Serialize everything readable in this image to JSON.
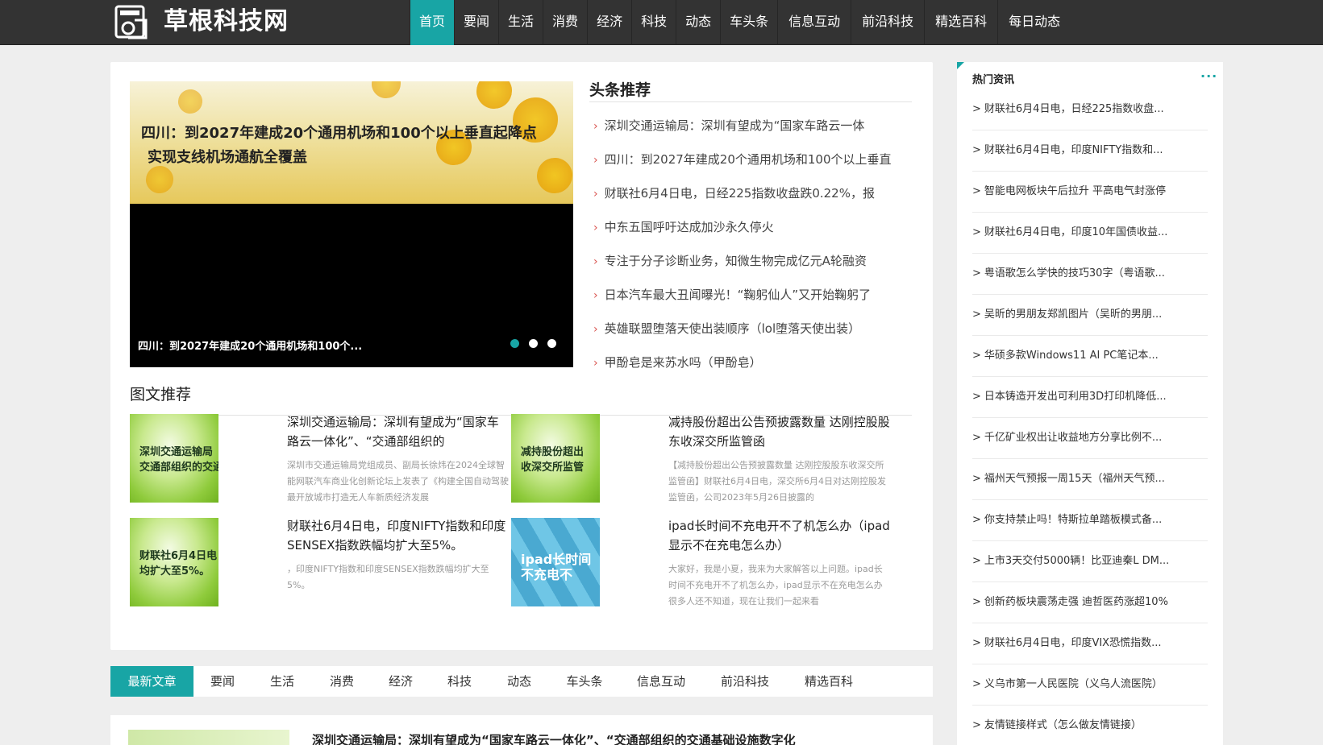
{
  "site": {
    "name": "草根科技网",
    "logo_icon": "news-logo-icon"
  },
  "nav": {
    "items": [
      "首页",
      "要闻",
      "生活",
      "消费",
      "经济",
      "科技",
      "动态",
      "车头条",
      "信息互动",
      "前沿科技",
      "精选百科",
      "每日动态"
    ],
    "active_index": 0
  },
  "slider": {
    "headline_line1": "四川：到2027年建成20个通用机场和100个以上垂直起降点",
    "headline_line2": "实现支线机场通航全覆盖",
    "caption": "四川：到2027年建成20个通用机场和100个...",
    "dots": 3,
    "active_dot": 0
  },
  "headlines": {
    "title": "头条推荐",
    "items": [
      "深圳交通运输局：深圳有望成为“国家车路云一体",
      "四川：到2027年建成20个通用机场和100个以上垂直",
      "财联社6月4日电，日经225指数收盘跌0.22%，报",
      "中东五国呼吁达成加沙永久停火",
      "专注于分子诊断业务，知微生物完成亿元A轮融资",
      "日本汽车最大丑闻曝光！“鞠躬仙人”又开始鞠躬了",
      "英雄联盟堕落天使出装顺序（lol堕落天使出装）",
      "甲酚皂是来苏水吗（甲酚皂）"
    ]
  },
  "picture_news": {
    "title": "图文推荐",
    "items": [
      {
        "thumb_text": "深圳交通运输局\n交通部组织的交通",
        "headline": "深圳交通运输局：深圳有望成为“国家车路云一体化”、“交通部组织的",
        "desc": "深圳市交通运输局党组成员、副局长徐炜在2024全球智能网联汽车商业化创新论坛上发表了《构建全国自动驾驶最开放城市打造无人车新质经济发展"
      },
      {
        "thumb_text": "减持股份超出\n收深交所监管",
        "headline": "减持股份超出公告预披露数量 达刚控股股东收深交所监管函",
        "desc": "【减持股份超出公告预披露数量 达刚控股股东收深交所监管函】财联社6月4日电，深交所6月4日对达刚控股发监管函，公司2023年5月26日披露的"
      },
      {
        "thumb_text": "财联社6月4日电\n均扩大至5%。",
        "headline": "财联社6月4日电，印度NIFTY指数和印度SENSEX指数跌幅均扩大至5%。",
        "desc": "，印度NIFTY指数和印度SENSEX指数跌幅均扩大至5%。"
      },
      {
        "thumb_text": "ipad长时间\n不充电不",
        "headline": "ipad长时间不充电开不了机怎么办（ipad显示不在充电怎么办）",
        "desc": "大家好，我是小夏，我来为大家解答以上问题。ipad长时间不充电开不了机怎么办，ipad显示不在充电怎么办很多人还不知道，现在让我们一起来看"
      }
    ]
  },
  "tabs": {
    "items": [
      "最新文章",
      "要闻",
      "生活",
      "消费",
      "经济",
      "科技",
      "动态",
      "车头条",
      "信息互动",
      "前沿科技",
      "精选百科"
    ],
    "active_index": 0
  },
  "latest": {
    "first_title": "深圳交通运输局：深圳有望成为“国家车路云一体化”、“交通部组织的交通基础设施数字化"
  },
  "hot": {
    "title": "热门资讯",
    "more": "···",
    "items": [
      "财联社6月4日电，日经225指数收盘...",
      "财联社6月4日电，印度NIFTY指数和...",
      "智能电网板块午后拉升 平高电气封涨停",
      "财联社6月4日电，印度10年国债收益...",
      "粤语歌怎么学快的技巧30字（粤语歌...",
      "吴昕的男朋友郑凯图片（吴昕的男朋...",
      "华硕多款Windows11 AI PC笔记本...",
      "日本铸造开发出可利用3D打印机降低...",
      "千亿矿业权出让收益地方分享比例不...",
      "福州天气预报一周15天（福州天气预...",
      "你支持禁止吗！特斯拉单踏板模式备...",
      "上市3天交付5000辆！比亚迪秦L DM...",
      "创新药板块震荡走强 迪哲医药涨超10%",
      "财联社6月4日电，印度VIX恐慌指数...",
      "义乌市第一人民医院（义乌人流医院）",
      "友情链接样式（怎么做友情链接）"
    ]
  },
  "colors": {
    "accent": "#18a5a5",
    "topbar": "#333333",
    "arrow": "#d9534f"
  }
}
